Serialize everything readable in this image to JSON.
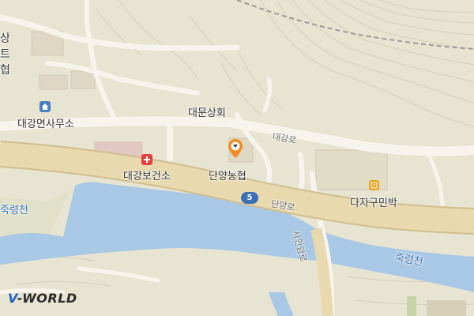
{
  "map": {
    "brand": {
      "prefix": "V",
      "rest": "-WORLD",
      "accent": "#1f5fbf"
    },
    "colors": {
      "land": "#e8e4d2",
      "road": "#f7f4ee",
      "major_road": "#e8d9ae",
      "river": "#a8c8e6",
      "green": "#c9d6b3",
      "contour": "#d8d2bd",
      "marker": "#f28a1e"
    },
    "labels": {
      "myeon_office": "대강면사무소",
      "daemun_store": "대문상회",
      "health_center": "대강보건소",
      "danyang_nonghyup": "단양농협",
      "dajagu_minbak": "다자구민박",
      "daegang_ro": "대강로",
      "danyang_ro": "단양로",
      "sainam_ro": "사인암로",
      "jukryeong_stream_left": "죽령천",
      "jukryeong_stream_right": "죽령천",
      "route_number": "5",
      "top_left_fragment": "트",
      "top_left_fragment2": "협",
      "top_left_fragment3": "상"
    },
    "icons": {
      "office": "building-icon",
      "hospital": "hospital-cross-icon",
      "lodging": "lodging-icon",
      "marker": "location-pin-icon",
      "route": "route-shield-icon"
    }
  }
}
